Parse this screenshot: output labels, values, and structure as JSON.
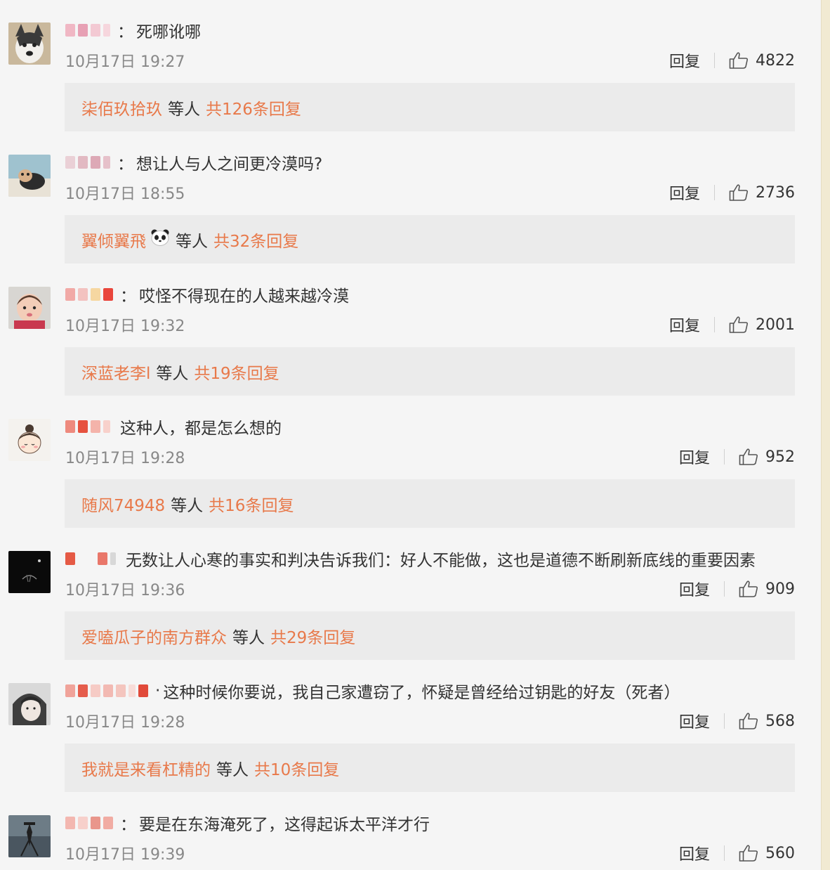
{
  "comments": [
    {
      "colon": "：",
      "text": "死哪讹哪",
      "time": "10月17日 19:27",
      "reply": "回复",
      "likes": "4822",
      "sub_user": "柒佰玖拾玖",
      "sub_mid": "等人",
      "sub_count": "共126条回复"
    },
    {
      "colon": "：",
      "text": "想让人与人之间更冷漠吗?",
      "time": "10月17日 18:55",
      "reply": "回复",
      "likes": "2736",
      "sub_user": "翼倾翼飛",
      "sub_mid": "等人",
      "sub_count": "共32条回复"
    },
    {
      "colon": "：",
      "text": "哎怪不得现在的人越来越冷漠",
      "time": "10月17日 19:32",
      "reply": "回复",
      "likes": "2001",
      "sub_user": "深蓝老李l",
      "sub_mid": "等人",
      "sub_count": "共19条回复"
    },
    {
      "colon": "",
      "text": "这种人，都是怎么想的",
      "time": "10月17日 19:28",
      "reply": "回复",
      "likes": "952",
      "sub_user": "随风74948",
      "sub_mid": "等人",
      "sub_count": "共16条回复"
    },
    {
      "colon": "",
      "text": "无数让人心寒的事实和判决告诉我们：好人不能做，这也是道德不断刷新底线的重要因素",
      "time": "10月17日 19:36",
      "reply": "回复",
      "likes": "909",
      "sub_user": "爱嗑瓜子的南方群众",
      "sub_mid": "等人",
      "sub_count": "共29条回复"
    },
    {
      "colon": "·",
      "text": "这种时候你要说，我自己家遭窃了，怀疑是曾经给过钥匙的好友（死者）",
      "time": "10月17日 19:28",
      "reply": "回复",
      "likes": "568",
      "sub_user": "我就是来看杠精的",
      "sub_mid": "等人",
      "sub_count": "共10条回复"
    },
    {
      "colon": "：",
      "text": "要是在东海淹死了，这得起诉太平洋才行",
      "time": "10月17日 19:39",
      "reply": "回复",
      "likes": "560"
    }
  ],
  "colors": {
    "accent": "#e8794a",
    "background": "#f5f5f5",
    "reply_box": "#ebebeb",
    "time": "#888888"
  },
  "icons": {
    "like": "thumbs-up-outline-icon",
    "panda": "panda-emoji-icon"
  }
}
